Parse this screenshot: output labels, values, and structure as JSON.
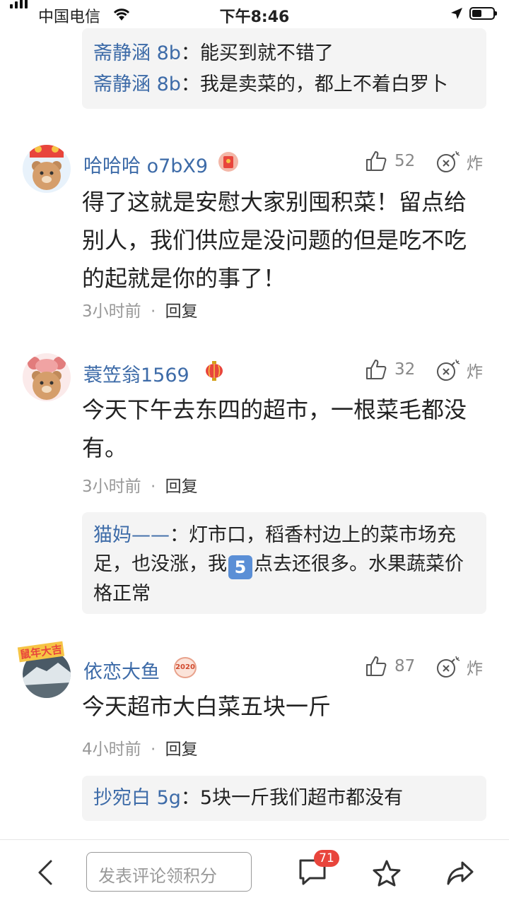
{
  "status_bar": {
    "carrier": "中国电信",
    "time": "下午8:46"
  },
  "top_replies": [
    {
      "name": "斋静涵 8b",
      "text": "：能买到就不错了"
    },
    {
      "name": "斋静涵 8b",
      "text": "：我是卖菜的，都上不着白罗卜"
    }
  ],
  "comments": [
    {
      "username": "哈哈哈 o7bX9",
      "likes": "52",
      "bomb_label": "炸",
      "content": "得了这就是安慰大家别囤积菜！留点给别人，我们供应是没问题的但是吃不吃的起就是你的事了！",
      "time": "3小时前",
      "separator": "·",
      "reply_label": "回复"
    },
    {
      "username": "蓑笠翁1569",
      "likes": "32",
      "bomb_label": "炸",
      "content": "今天下午去东四的超市，一根菜毛都没有。",
      "time": "3小时前",
      "separator": "·",
      "reply_label": "回复",
      "replies": [
        {
          "name": "猫妈——",
          "text_before": "：灯市口，稻香村边上的菜市场充足，也没涨，我",
          "emoji": "5",
          "text_after": "点去还很多。水果蔬菜价格正常"
        }
      ]
    },
    {
      "username": "依恋大鱼",
      "badge_text": "2020",
      "likes": "87",
      "bomb_label": "炸",
      "content": "今天超市大白菜五块一斤",
      "time": "4小时前",
      "separator": "·",
      "reply_label": "回复",
      "replies": [
        {
          "name": "抄宛白 5g",
          "text": "：5块一斤我们超市都没有"
        }
      ]
    }
  ],
  "avatar2_sticker_text": "鼠年大吉",
  "bottom_bar": {
    "input_placeholder": "发表评论领积分",
    "comment_count": "71"
  },
  "colors": {
    "username": "#3d6ba8",
    "badge_red": "#e8453c",
    "reply_bg": "#f4f4f4"
  },
  "icons": [
    "signal-icon",
    "wifi-icon",
    "location-icon",
    "battery-icon",
    "thumb-up-icon",
    "bomb-icon",
    "back-icon",
    "comment-icon",
    "star-icon",
    "share-icon"
  ]
}
